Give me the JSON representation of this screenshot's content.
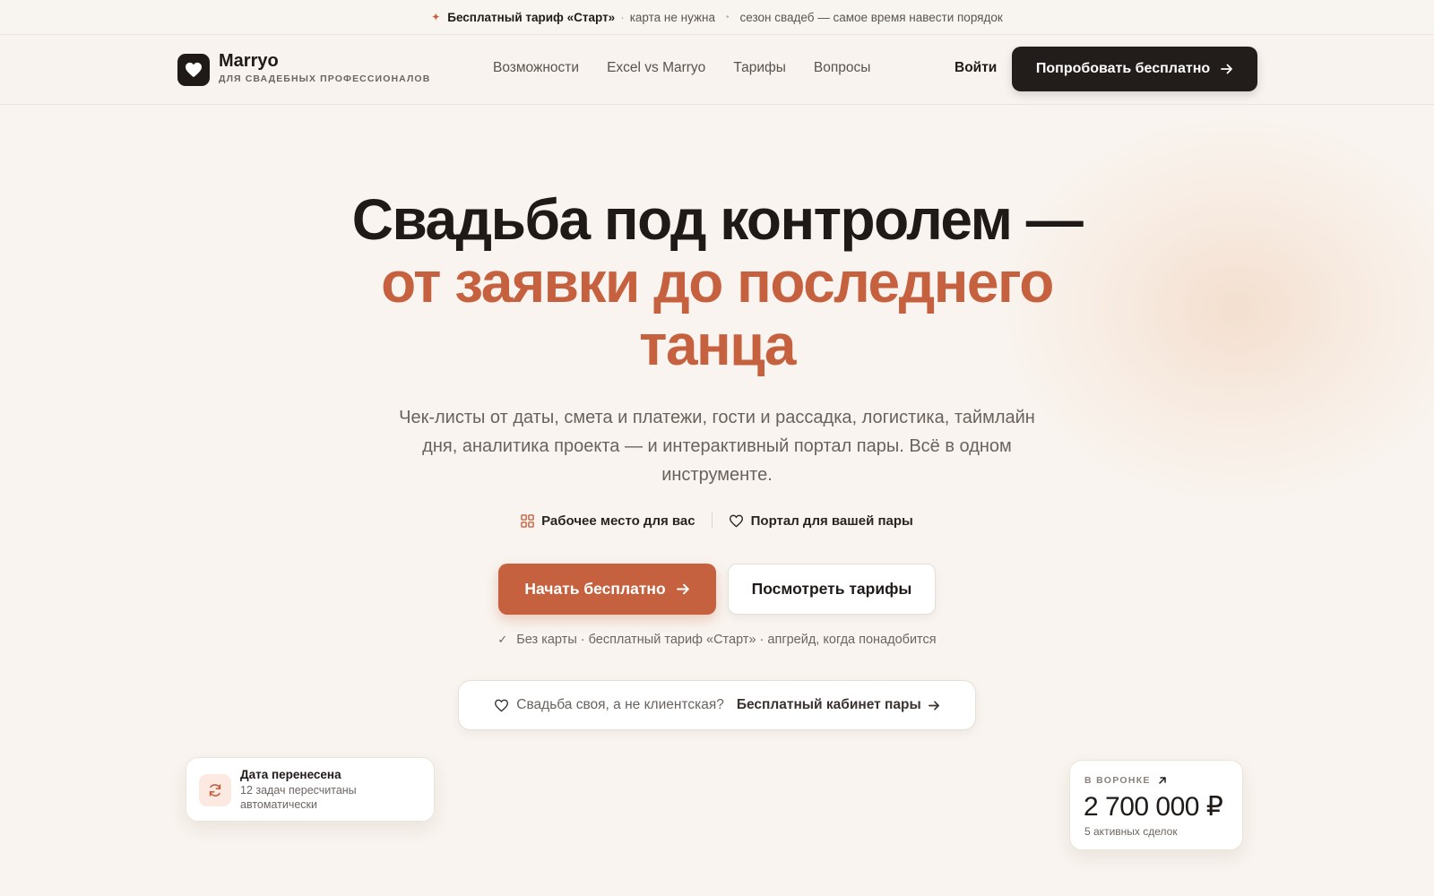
{
  "announcement": {
    "highlight": "Бесплатный тариф «Старт»",
    "item1": "карта не нужна",
    "item2": "сезон свадеб — самое время навести порядок"
  },
  "header": {
    "logo_name": "Marryo",
    "logo_tagline": "ДЛЯ СВАДЕБНЫХ ПРОФЕССИОНАЛОВ",
    "nav": [
      "Возможности",
      "Excel vs Marryo",
      "Тарифы",
      "Вопросы"
    ],
    "login_label": "Войти",
    "cta_label": "Попробовать бесплатно"
  },
  "hero": {
    "title_line1": "Свадьба под контролем —",
    "title_line2": "от заявки до последнего",
    "title_line3": "танца",
    "lead": "Чек-листы от даты, смета и платежи, гости и рассадка, логистика, таймлайн дня, аналитика проекта — и интерактивный портал пары. Всё в одном инструменте.",
    "mode_workspace": "Рабочее место для вас",
    "mode_portal": "Портал для вашей пары",
    "primary_button": "Начать бесплатно",
    "secondary_button": "Посмотреть тарифы",
    "note": "Без карты · бесплатный тариф «Старт» · апгрейд, когда понадобится",
    "couple_question": "Свадьба своя, а не клиентская?",
    "couple_link": "Бесплатный кабинет пары"
  },
  "card_reschedule": {
    "title": "Дата перенесена",
    "description": "12 задач пересчитаны автоматически"
  },
  "card_funnel": {
    "label": "В ВОРОНКЕ",
    "value": "2 700 000 ₽",
    "subtitle": "5 активных сделок"
  },
  "colors": {
    "accent": "#c6613f",
    "dark": "#1f1a17",
    "background": "#f9f4ef"
  }
}
